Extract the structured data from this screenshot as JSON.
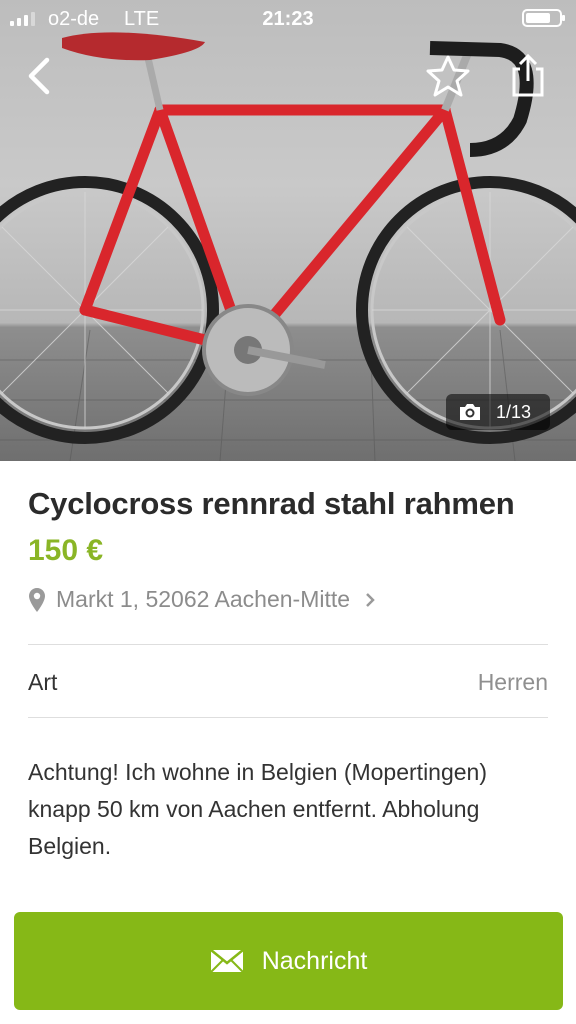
{
  "status_bar": {
    "carrier": "o2-de",
    "network": "LTE",
    "time": "21:23"
  },
  "icons": {
    "back": "chevron-left-icon",
    "favorite": "star-outline-icon",
    "share": "share-icon",
    "camera": "camera-icon",
    "location": "map-pin-icon",
    "chevron": "chevron-right-icon",
    "message": "envelope-icon"
  },
  "gallery": {
    "counter": "1/13"
  },
  "listing": {
    "title": "Cyclocross rennrad stahl rahmen",
    "price": "150 €",
    "location": "Markt 1, 52062 Aachen-Mitte",
    "attributes": [
      {
        "label": "Art",
        "value": "Herren"
      }
    ],
    "description": [
      "Achtung! Ich wohne in Belgien (Mopertingen)",
      "knapp 50 km von Aachen entfernt. Abholung Belgien."
    ]
  },
  "action": {
    "message_label": "Nachricht"
  },
  "colors": {
    "price": "#8ab526",
    "button": "#86b817",
    "bike_frame": "#d9262c"
  }
}
